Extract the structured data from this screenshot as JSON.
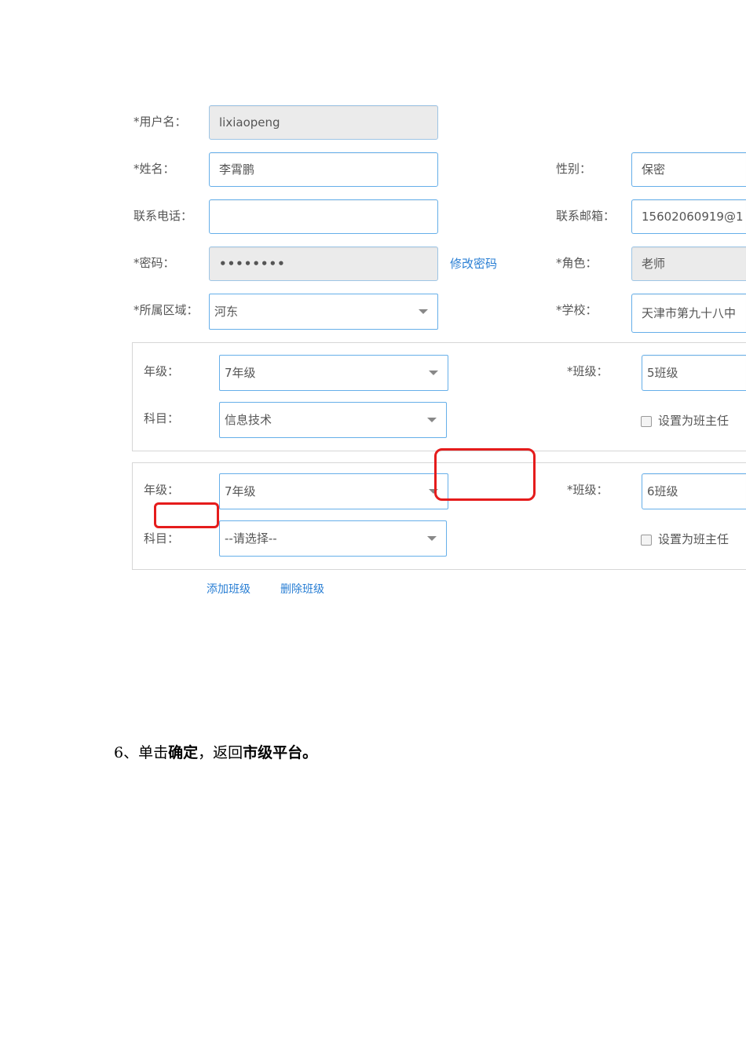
{
  "form": {
    "username": {
      "label": "*用户名：",
      "value": "lixiaopeng"
    },
    "name": {
      "label": "*姓名：",
      "value": "李霄鹏"
    },
    "gender": {
      "label": "性别：",
      "value": "保密"
    },
    "phone": {
      "label": "联系电话：",
      "value": ""
    },
    "email": {
      "label": "联系邮箱：",
      "value": "15602060919@1"
    },
    "password": {
      "label": "*密码：",
      "value": "••••••••",
      "change_link": "修改密码"
    },
    "role": {
      "label": "*角色：",
      "value": "老师"
    },
    "region": {
      "label": "*所属区域：",
      "value": "河东"
    },
    "school": {
      "label": "*学校：",
      "value": "天津市第九十八中"
    }
  },
  "classes": [
    {
      "grade_label": "年级：",
      "grade_value": "7年级",
      "class_label": "*班级：",
      "class_value": "5班级",
      "subject_label": "科目：",
      "subject_value": "信息技术",
      "head_teacher_label": "设置为班主任",
      "head_teacher_checked": false
    },
    {
      "grade_label": "年级：",
      "grade_value": "7年级",
      "class_label": "*班级：",
      "class_value": "6班级",
      "subject_label": "科目：",
      "subject_value": "--请选择--",
      "head_teacher_label": "设置为班主任",
      "head_teacher_checked": false
    }
  ],
  "actions": {
    "add_class": "添加班级",
    "delete_class": "删除班级"
  },
  "doc_text": {
    "prefix": "6、单击",
    "confirm": "确定",
    "middle": "，返回",
    "target": "市级平台",
    "suffix": "。"
  },
  "colors": {
    "highlight": "#e51c1c",
    "link": "#2a7fd4",
    "input_border": "#66afe9"
  }
}
